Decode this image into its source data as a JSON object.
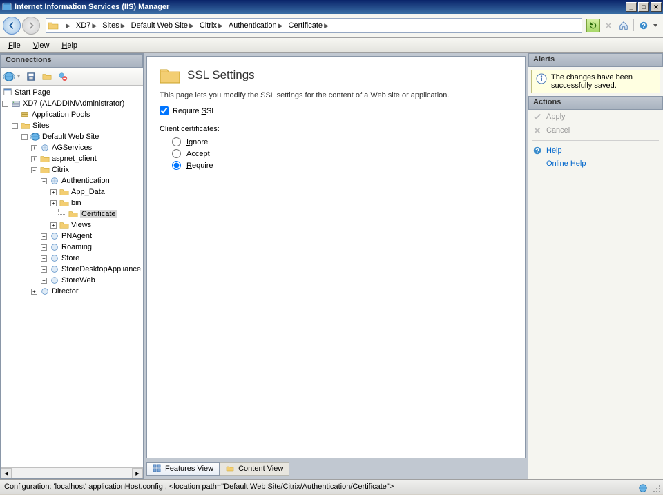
{
  "window": {
    "title": "Internet Information Services (IIS) Manager"
  },
  "breadcrumb": [
    "XD7",
    "Sites",
    "Default Web Site",
    "Citrix",
    "Authentication",
    "Certificate"
  ],
  "menu": {
    "file": "File",
    "view": "View",
    "help": "Help"
  },
  "connections": {
    "header": "Connections",
    "start_page": "Start Page",
    "server": "XD7 (ALADDIN\\Administrator)",
    "app_pools": "Application Pools",
    "sites": "Sites",
    "default_site": "Default Web Site",
    "agservices": "AGServices",
    "aspnet_client": "aspnet_client",
    "citrix": "Citrix",
    "authentication": "Authentication",
    "app_data": "App_Data",
    "bin": "bin",
    "certificate": "Certificate",
    "views": "Views",
    "pnagent": "PNAgent",
    "roaming": "Roaming",
    "store": "Store",
    "store_desktop_appliance": "StoreDesktopAppliance",
    "storeweb": "StoreWeb",
    "director": "Director"
  },
  "ssl": {
    "title": "SSL Settings",
    "desc": "This page lets you modify the SSL settings for the content of a Web site or application.",
    "require_ssl_label": "Require SSL",
    "require_ssl_checked": true,
    "client_cert_label": "Client certificates:",
    "ignore": "Ignore",
    "accept": "Accept",
    "require": "Require",
    "selected": "require"
  },
  "tabs": {
    "features": "Features View",
    "content": "Content View"
  },
  "alerts": {
    "header": "Alerts",
    "message": "The changes have been successfully saved."
  },
  "actions": {
    "header": "Actions",
    "apply": "Apply",
    "cancel": "Cancel",
    "help": "Help",
    "online_help": "Online Help"
  },
  "status": {
    "text": "Configuration: 'localhost' applicationHost.config , <location path=\"Default Web Site/Citrix/Authentication/Certificate\">"
  }
}
